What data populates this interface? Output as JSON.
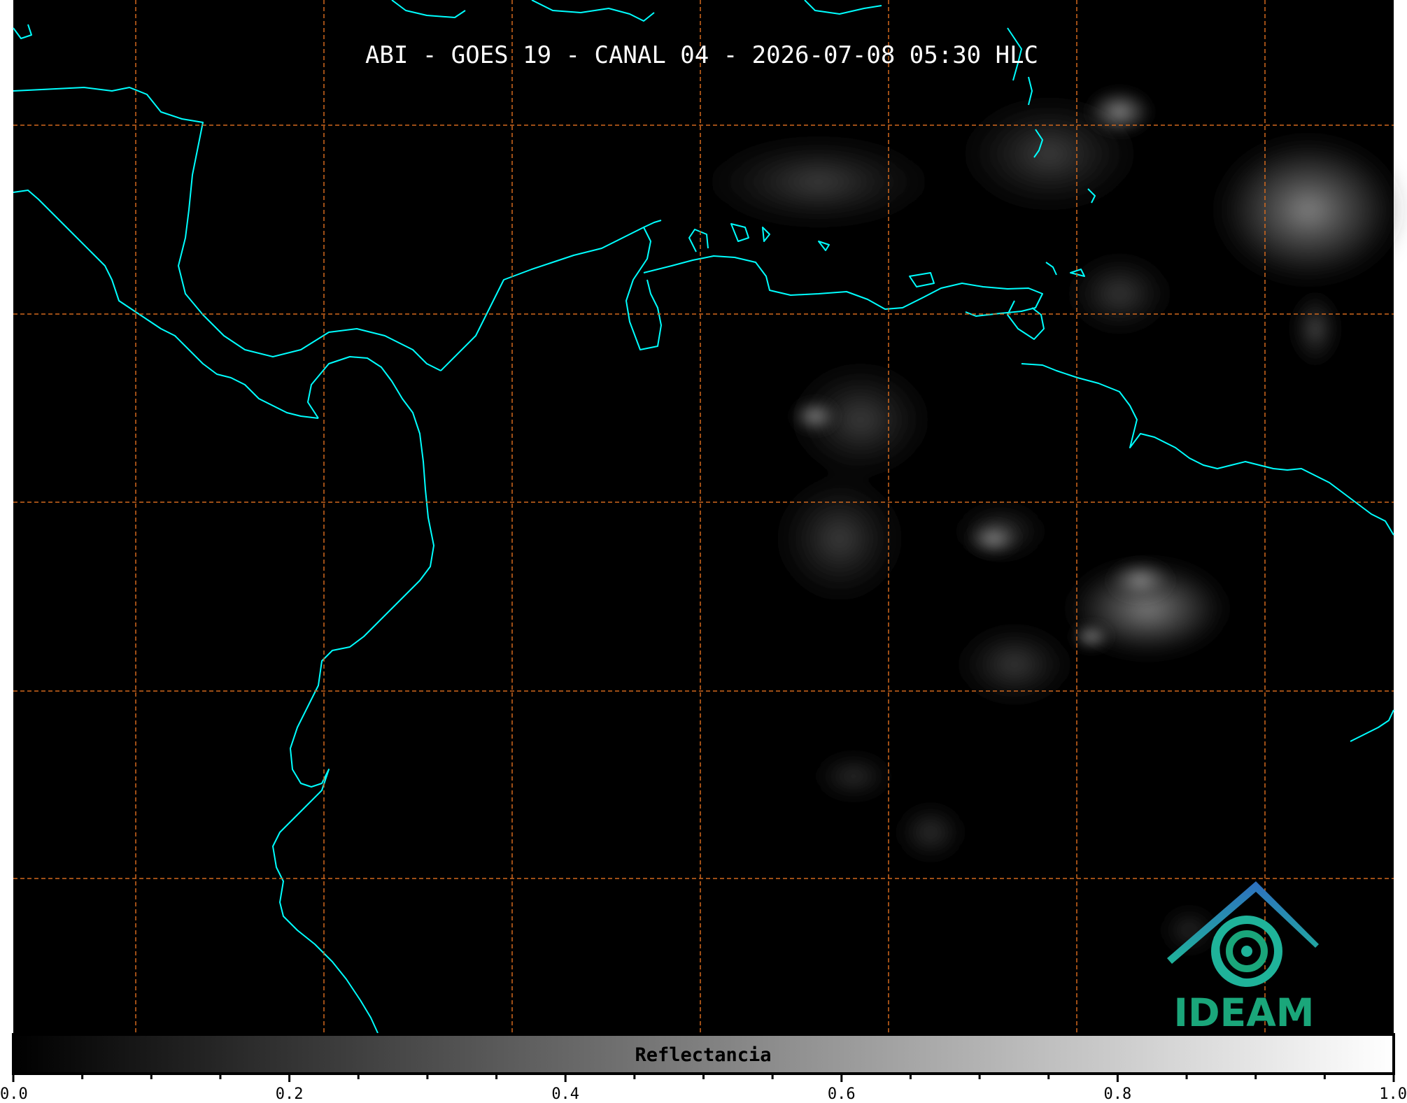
{
  "title": "ABI - GOES 19 - CANAL 04 - 2026-07-08 05:30 HLC",
  "logo": {
    "text": "IDEAM",
    "icon": "ideam-spiral-house-logo"
  },
  "colorbar": {
    "label": "Reflectancia",
    "range": [
      0.0,
      1.0
    ],
    "ticks": [
      "0.0",
      "0.2",
      "0.4",
      "0.6",
      "0.8",
      "1.0"
    ],
    "gradient": [
      "#000000",
      "#ffffff"
    ]
  },
  "colors": {
    "background": "#000000",
    "coastline": "#00ffff",
    "gridline": "#d2691e",
    "logo_text": "#1aa67a",
    "logo_blue": "#2e7bb8",
    "logo_teal": "#1fb39a"
  }
}
